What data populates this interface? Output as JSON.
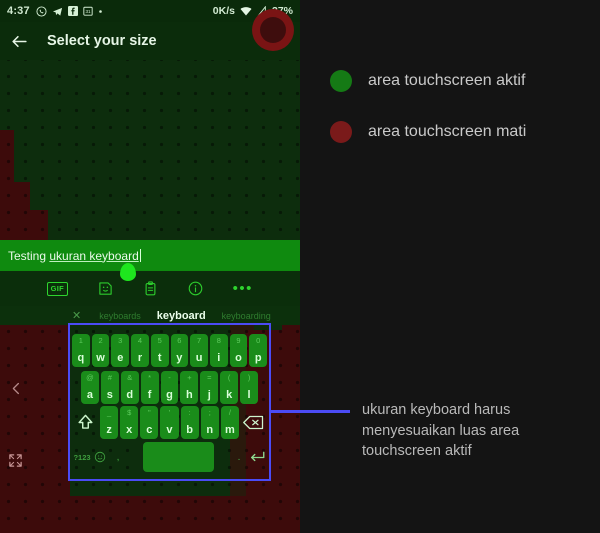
{
  "phone": {
    "status_bar": {
      "time": "4:37",
      "left_icons": [
        "whatsapp-icon",
        "telegram-icon",
        "facebook-icon",
        "calendar-icon",
        "dot-icon"
      ],
      "network_speed": "0K/s",
      "right_icons": [
        "wifi-icon",
        "signal-icon"
      ],
      "battery": "37%"
    },
    "app_bar": {
      "back_label": "back-arrow",
      "title": "Select your size",
      "avatar": "avatar"
    },
    "text_field": {
      "prefix": "Testing ",
      "typed": "ukuran keyboard",
      "full_value": "Testing ukuran keyboard"
    },
    "toolbar": {
      "items": [
        "GIF",
        "sticker-icon",
        "clipboard-icon",
        "info-icon",
        "more-icon"
      ],
      "gif_label": "GIF",
      "more_label": "•••"
    },
    "suggestions": {
      "close": "✕",
      "left": "keyboards",
      "center": "keyboard",
      "right": "keyboarding"
    },
    "keyboard": {
      "row1": [
        {
          "sup": "1",
          "key": "q"
        },
        {
          "sup": "2",
          "key": "w"
        },
        {
          "sup": "3",
          "key": "e"
        },
        {
          "sup": "4",
          "key": "r"
        },
        {
          "sup": "5",
          "key": "t"
        },
        {
          "sup": "6",
          "key": "y"
        },
        {
          "sup": "7",
          "key": "u"
        },
        {
          "sup": "8",
          "key": "i"
        },
        {
          "sup": "9",
          "key": "o"
        },
        {
          "sup": "0",
          "key": "p"
        }
      ],
      "row2": [
        {
          "sup": "@",
          "key": "a"
        },
        {
          "sup": "#",
          "key": "s"
        },
        {
          "sup": "&",
          "key": "d"
        },
        {
          "sup": "*",
          "key": "f"
        },
        {
          "sup": "-",
          "key": "g"
        },
        {
          "sup": "+",
          "key": "h"
        },
        {
          "sup": "=",
          "key": "j"
        },
        {
          "sup": "(",
          "key": "k"
        },
        {
          "sup": ")",
          "key": "l"
        }
      ],
      "row3": [
        {
          "sup": "_",
          "key": "z"
        },
        {
          "sup": "$",
          "key": "x"
        },
        {
          "sup": "\"",
          "key": "c"
        },
        {
          "sup": "'",
          "key": "v"
        },
        {
          "sup": ":",
          "key": "b"
        },
        {
          "sup": ";",
          "key": "n"
        },
        {
          "sup": "/",
          "key": "m"
        }
      ],
      "shift": "shift-key",
      "backspace": "backspace-key",
      "row4": {
        "symbols": "?123",
        "emoji": "emoji-key",
        "comma": ",",
        "space": "space-key",
        "period": ".",
        "enter": "enter-key"
      }
    },
    "nav": {
      "back": "back-chevron",
      "expand": "expand-icon"
    }
  },
  "annotations": {
    "legend": [
      {
        "color": "#157a15",
        "label": "area touchscreen aktif"
      },
      {
        "color": "#7a1a1a",
        "label": "area touchscreen mati"
      }
    ],
    "callout": "ukuran keyboard harus menyesuaikan luas area touchscreen aktif",
    "highlight_color": "#4b4bf5"
  },
  "colors": {
    "active_green": "#157a15",
    "inactive_red": "#7a1a1a",
    "panel_bg": "#141414",
    "highlight": "#4b4bf5"
  }
}
